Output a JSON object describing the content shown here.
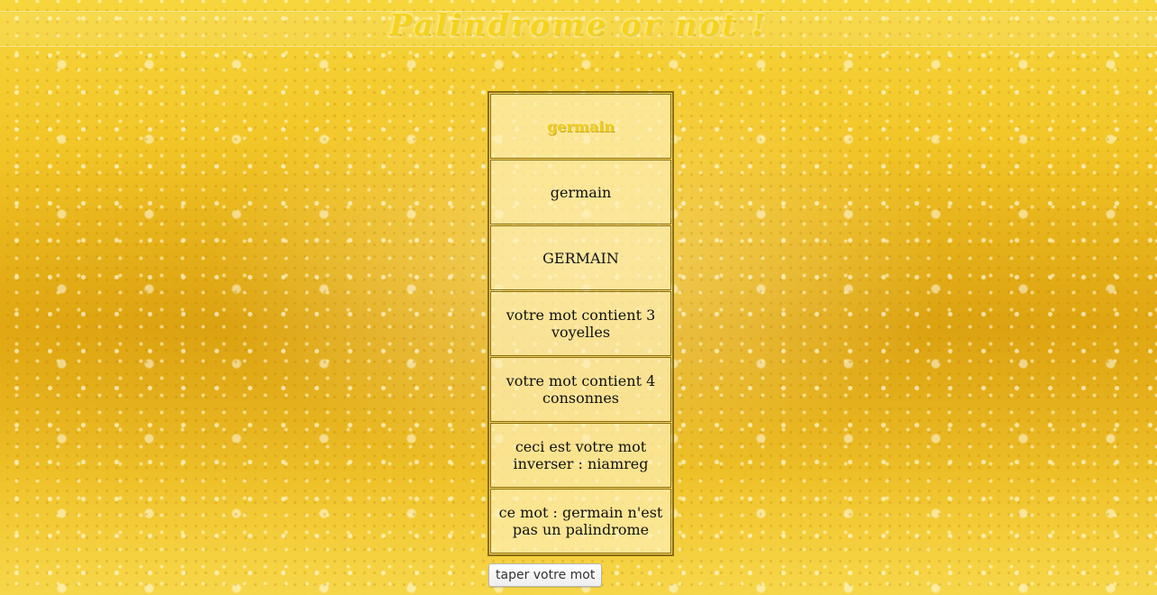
{
  "page": {
    "title": "Palindrome or not !"
  },
  "results": {
    "word_styled": "germain",
    "lowercase": "germain",
    "uppercase": "GERMAIN",
    "vowels": "votre mot contient 3 voyelles",
    "consonants": "votre mot contient 4 consonnes",
    "reversed": "ceci est votre mot inverser : niamreg",
    "verdict": "ce mot : germain n'est pas un palindrome"
  },
  "controls": {
    "input_button_label": "taper votre mot"
  },
  "colors": {
    "accent_gold": "#f5d21c",
    "border_gold": "#8a6d10"
  }
}
